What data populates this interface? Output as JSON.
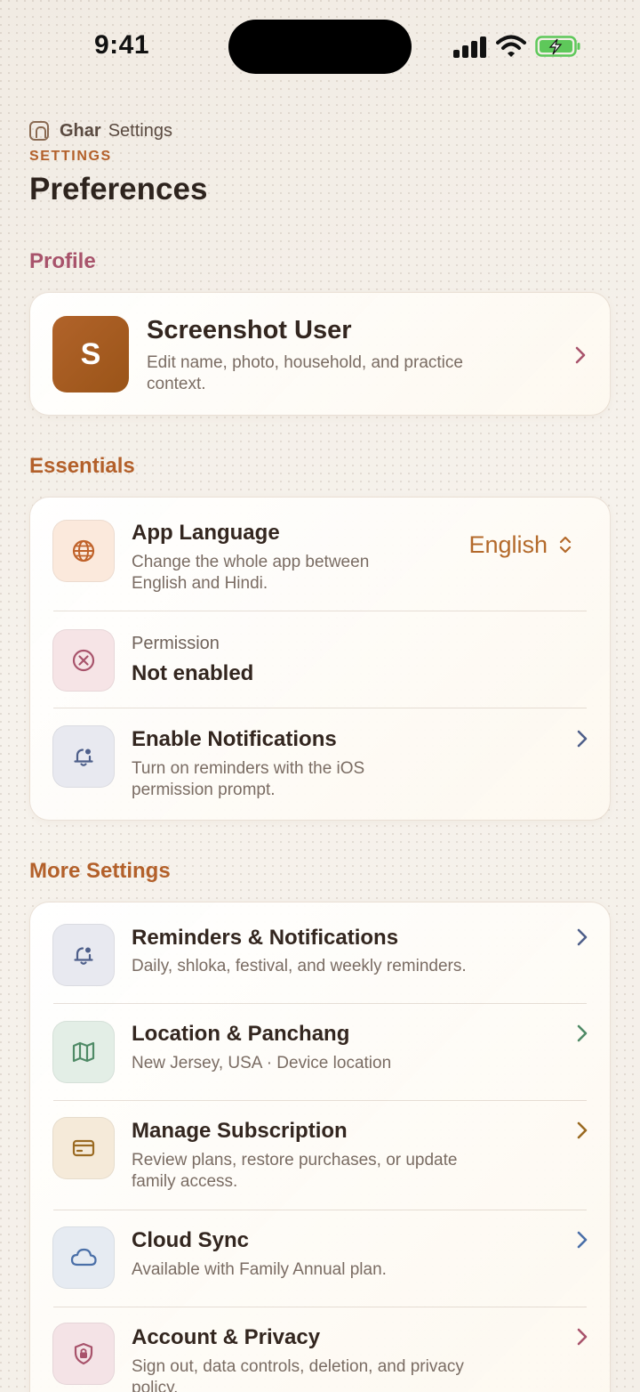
{
  "status": {
    "time": "9:41"
  },
  "header": {
    "app_name": "Ghar",
    "crumb_page": "Settings",
    "eyebrow": "SETTINGS",
    "title": "Preferences"
  },
  "sections": {
    "profile": "Profile",
    "essentials": "Essentials",
    "more": "More Settings"
  },
  "profile": {
    "initial": "S",
    "name": "Screenshot User",
    "subtitle": "Edit name, photo, household, and practice context."
  },
  "essentials": {
    "language": {
      "title": "App Language",
      "subtitle": "Change the whole app between English and Hindi.",
      "value": "English"
    },
    "permission": {
      "label": "Permission",
      "value": "Not enabled"
    },
    "notifications": {
      "title": "Enable Notifications",
      "subtitle": "Turn on reminders with the iOS permission prompt."
    }
  },
  "more": {
    "reminders": {
      "title": "Reminders & Notifications",
      "subtitle": "Daily, shloka, festival, and weekly reminders."
    },
    "location": {
      "title": "Location & Panchang",
      "subtitle": "New Jersey, USA · Device location"
    },
    "subscription": {
      "title": "Manage Subscription",
      "subtitle": "Review plans, restore purchases, or update family access."
    },
    "cloud": {
      "title": "Cloud Sync",
      "subtitle": "Available with Family Annual plan."
    },
    "account": {
      "title": "Account & Privacy",
      "subtitle": "Sign out, data controls, deletion, and privacy policy."
    }
  },
  "colors": {
    "accent_orange": "#b3602a",
    "accent_rose": "#a8536b",
    "accent_slate": "#4e5f8a",
    "accent_green": "#4f8a66",
    "accent_gold": "#9a6a22"
  },
  "icons": {
    "language": "globe-icon",
    "permission": "x-circle-icon",
    "notifications": "bell-icon",
    "reminders": "bell-icon",
    "location": "map-icon",
    "subscription": "card-icon",
    "cloud": "cloud-icon",
    "account": "shield-lock-icon"
  }
}
